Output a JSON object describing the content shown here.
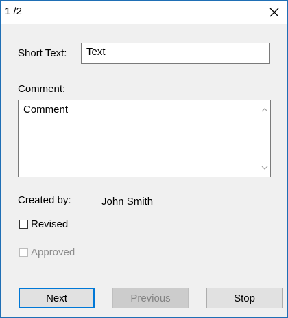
{
  "window": {
    "title": "1 /2",
    "close_glyph": "✕"
  },
  "form": {
    "short_text_label": "Short Text:",
    "short_text_value": "Text",
    "comment_label": "Comment:",
    "comment_value": "Comment",
    "created_by_label": "Created by:",
    "created_by_value": "John Smith",
    "revised_label": "Revised",
    "revised_checked": false,
    "approved_label": "Approved",
    "approved_checked": false,
    "approved_enabled": false
  },
  "buttons": {
    "next_label": "Next",
    "previous_label": "Previous",
    "previous_enabled": false,
    "stop_label": "Stop"
  },
  "colors": {
    "accent": "#0078d7",
    "window_border": "#1f6fb5",
    "dialog_bg": "#f0f0f0",
    "disabled_text": "#838383"
  }
}
